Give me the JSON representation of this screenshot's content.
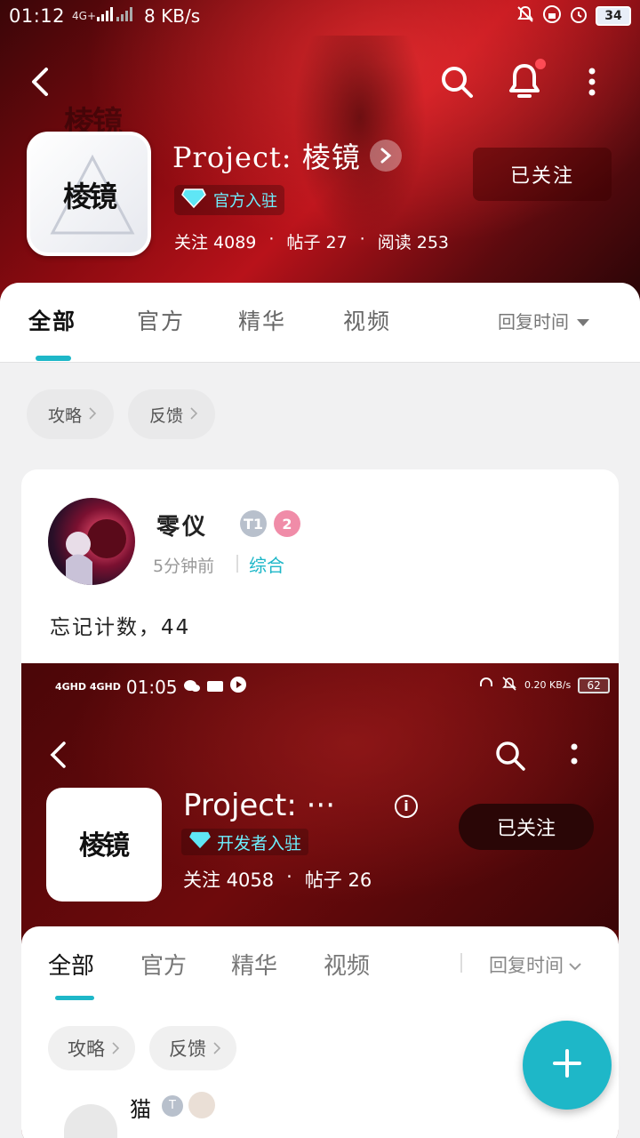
{
  "status_bar": {
    "time": "01:12",
    "network": "4G+",
    "speed": "8 KB/s",
    "battery": "34"
  },
  "header": {
    "title": "Project: 棱镜",
    "badge": "官方入驻",
    "stats": {
      "follow": "关注 4089",
      "posts": "帖子 27",
      "reads": "阅读 253"
    },
    "follow_button": "已关注",
    "logo_text": "棱镜"
  },
  "tabs": {
    "items": [
      "全部",
      "官方",
      "精华",
      "视频"
    ],
    "active": "全部",
    "sort_label": "回复时间"
  },
  "chips": [
    "攻略",
    "反馈"
  ],
  "post": {
    "author": "零仪",
    "level_badge": "T1",
    "rank_badge": "2",
    "time": "5分钟前",
    "category": "综合",
    "text": "忘记计数，44"
  },
  "embedded_screenshot": {
    "status_time": "01:05",
    "status_net": "4GHD 4GHD",
    "status_speed": "0.20 KB/s",
    "battery": "62",
    "title": "Project: ···",
    "info_glyph": "i",
    "badge": "开发者入驻",
    "stats": {
      "follow": "关注 4058",
      "posts": "帖子 26"
    },
    "follow_button": "已关注",
    "logo_text": "棱镜",
    "tabs": [
      "全部",
      "官方",
      "精华",
      "视频"
    ],
    "sort_label": "回复时间",
    "chips": [
      "攻略",
      "反馈"
    ],
    "next_author": "猫"
  },
  "fab_label": "+",
  "colors": {
    "accent": "#1eb7c8",
    "header_red": "#b8121a",
    "badge_cyan": "#6ef0ff"
  },
  "icons": [
    "back-icon",
    "search-icon",
    "bell-icon",
    "more-icon",
    "chevron-right-icon",
    "chevron-down-icon",
    "diamond-icon",
    "plus-icon"
  ]
}
